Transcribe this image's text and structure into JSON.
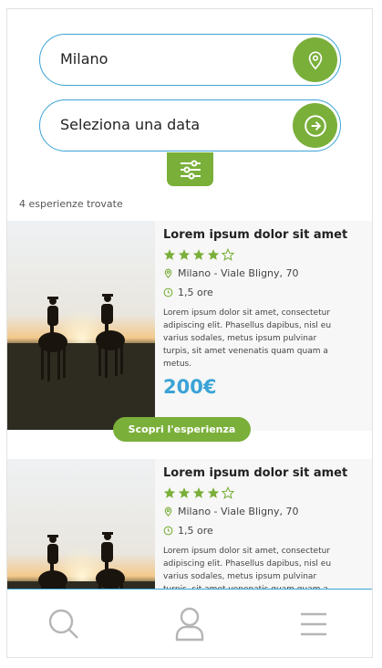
{
  "search": {
    "location_value": "Milano",
    "date_placeholder": "Seleziona una data"
  },
  "results": {
    "count_text": "4 esperienze trovate"
  },
  "cards": [
    {
      "title": "Lorem ipsum dolor sit amet",
      "rating": 4,
      "rating_max": 5,
      "location": "Milano - Viale Bligny, 70",
      "duration": "1,5 ore",
      "description": "Lorem ipsum dolor sit amet, consectetur adipiscing elit. Phasellus dapibus, nisl eu varius sodales, metus ipsum pulvinar turpis, sit amet venenatis quam quam a metus.",
      "price": "200€",
      "cta_label": "Scopri l'esperienza"
    },
    {
      "title": "Lorem ipsum dolor sit amet",
      "rating": 4,
      "rating_max": 5,
      "location": "Milano - Viale Bligny, 70",
      "duration": "1,5 ore",
      "description": "Lorem ipsum dolor sit amet, consectetur adipiscing elit. Phasellus dapibus, nisl eu varius sodales, metus ipsum pulvinar turpis, sit amet venenatis quam quam a metus."
    }
  ],
  "tabbar": {
    "icons": [
      "search-icon",
      "user-icon",
      "menu-icon"
    ]
  },
  "colors": {
    "accent_green": "#7aaf3a",
    "accent_blue": "#3ba3d6"
  }
}
